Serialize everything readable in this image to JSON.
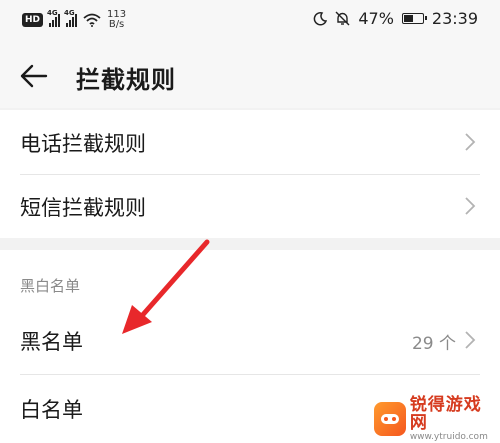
{
  "status_bar": {
    "hd_label": "HD",
    "net_tag": "4G",
    "net_tag2": "4G",
    "speed_value": "113",
    "speed_unit": "B/s",
    "battery_text": "47%",
    "time": "23:39"
  },
  "header": {
    "title": "拦截规则"
  },
  "rules": {
    "items": [
      {
        "label": "电话拦截规则"
      },
      {
        "label": "短信拦截规则"
      }
    ]
  },
  "lists": {
    "section_title": "黑白名单",
    "blacklist_label": "黑名单",
    "blacklist_count": "29 个",
    "whitelist_label": "白名单"
  },
  "watermark": {
    "title": "锐得游戏网",
    "url": "www.ytruido.com"
  },
  "colors": {
    "arrow": "#e8282b",
    "accent": "#d63b1f"
  }
}
